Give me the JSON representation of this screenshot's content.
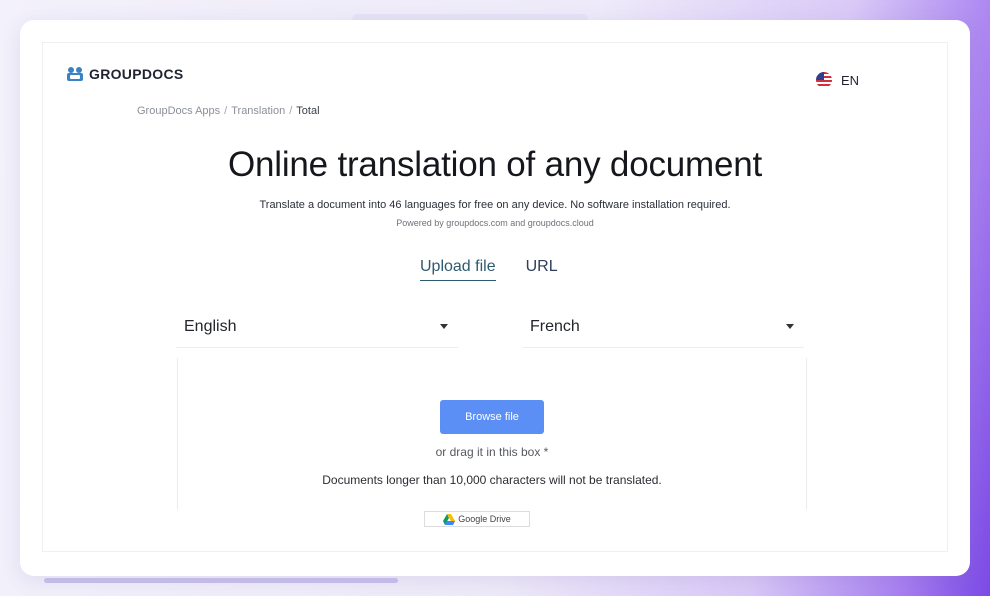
{
  "header": {
    "logo_text": "GROUPDOCS",
    "language": "EN"
  },
  "breadcrumb": {
    "items": [
      "GroupDocs Apps",
      "Translation"
    ],
    "current": "Total",
    "separator": "/"
  },
  "main": {
    "title": "Online translation of any document",
    "subtitle": "Translate a document into 46 languages for free on any device. No software installation required.",
    "powered_by": "Powered by groupdocs.com and groupdocs.cloud"
  },
  "tabs": [
    {
      "label": "Upload file",
      "active": true
    },
    {
      "label": "URL",
      "active": false
    }
  ],
  "selects": {
    "source_language": "English",
    "target_language": "French"
  },
  "upload": {
    "browse_label": "Browse file",
    "drag_hint": "or drag it in this box *",
    "limit_note": "Documents longer than 10,000 characters will not be translated.",
    "google_drive_label": "Google Drive"
  },
  "icons": {
    "logo": "groupdocs-logo-icon",
    "flag": "us-flag-icon",
    "caret": "chevron-down-icon",
    "drive": "google-drive-icon"
  },
  "colors": {
    "accent": "#5b8ff5",
    "tab_active": "#2f5a70",
    "logo_blue": "#3b82c4"
  }
}
